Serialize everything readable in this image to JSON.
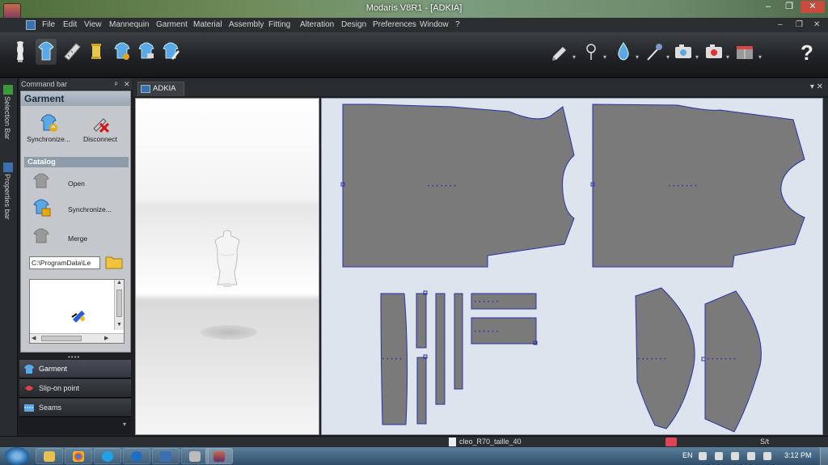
{
  "window": {
    "title": "Modaris V8R1 - [ADKIA]",
    "min_label": "–",
    "max_label": "❐",
    "close_label": "✕"
  },
  "menu": {
    "items": [
      "File",
      "Edit",
      "View",
      "Mannequin",
      "Garment",
      "Material",
      "Assembly",
      "Fitting",
      "Alteration",
      "Design",
      "Preferences",
      "Window",
      "?"
    ],
    "mdi_min": "–",
    "mdi_restore": "❐",
    "mdi_close": "✕"
  },
  "toolbar": {
    "left_icons": [
      "mannequin-icon",
      "garment-shirt-icon",
      "ruler-icon",
      "thread-spool-icon",
      "garment-info-icon",
      "garment-settings-icon",
      "garment-edit-icon"
    ],
    "right_icons": [
      "pen-tool-icon",
      "pin-icon",
      "water-drop-icon",
      "magic-wand-icon",
      "camera-icon",
      "camera-record-icon",
      "layout-icon"
    ],
    "arrow": "▾",
    "help_label": "?"
  },
  "vertical_tabs": [
    "Selection Bar",
    "Properties bar"
  ],
  "command_bar": {
    "title": "Command bar",
    "pin_label": "ᵖ",
    "close_label": "✕",
    "panel_title": "Garment",
    "synchronize_label": "Synchronize...",
    "disconnect_label": "Disconnect",
    "catalog_header": "Catalog",
    "catalog_items": [
      "Open",
      "Synchronize...",
      "Merge"
    ],
    "path_value": "C:\\ProgramData\\Le",
    "grip": "••••",
    "nav_buttons": [
      "Garment",
      "Slip-on point",
      "Seams"
    ],
    "nav_more": "▾"
  },
  "document": {
    "tab_label": "ADKIA",
    "controls": "▾ ✕"
  },
  "status": {
    "file_name": "cleo_R70_taille_40",
    "mode": "S/t"
  },
  "taskbar": {
    "language": "EN",
    "time": "3:12 PM"
  },
  "colors": {
    "pattern_fill": "#7a7a7a",
    "pattern_stroke": "#2b32a8",
    "view2d_bg": "#dde4ee",
    "accent_blue": "#3a6fb1"
  }
}
